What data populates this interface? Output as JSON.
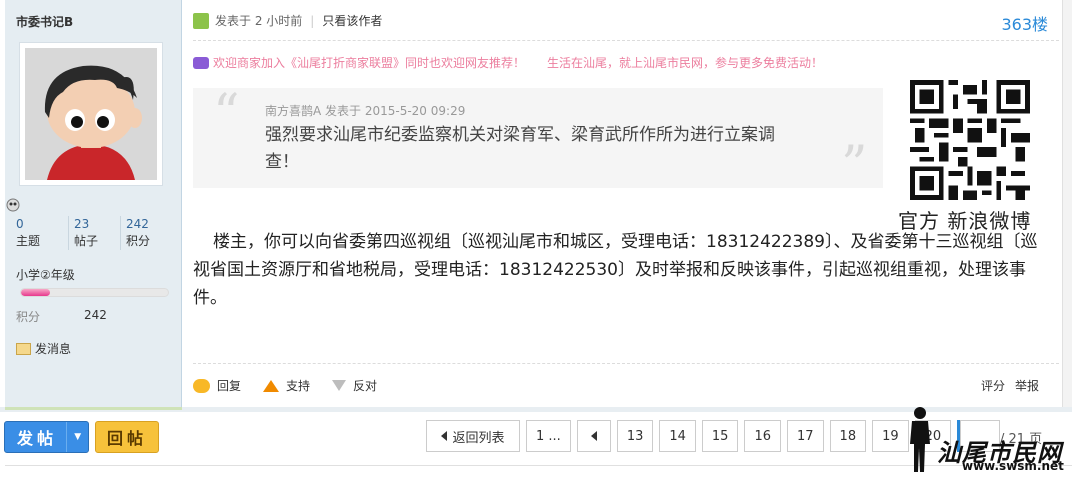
{
  "author": {
    "name": "市委书记B",
    "stats": [
      {
        "value": "0",
        "label": "主题"
      },
      {
        "value": "23",
        "label": "帖子"
      },
      {
        "value": "242",
        "label": "积分"
      }
    ],
    "level": "小学②年级",
    "level_progress": 0.2,
    "points_label": "积分",
    "points_value": "242",
    "pm_label": "发消息"
  },
  "post": {
    "posted_label": "发表于 2 小时前",
    "only_author": "只看该作者",
    "floor": "363楼",
    "ad_left": "欢迎商家加入《汕尾打折商家联盟》同时也欢迎网友推荐！",
    "ad_right": "生活在汕尾，就上汕尾市民网，参与更多免费活动！",
    "quote": {
      "meta": "南方喜鹊A 发表于 2015-5-20 09:29",
      "text": "强烈要求汕尾市纪委监察机关对梁育军、梁育武所作所为进行立案调查！"
    },
    "qr_caption": "官方 新浪微博",
    "body": "楼主，你可以向省委第四巡视组〔巡视汕尾市和城区，受理电话：18312422389〕、及省委第十三巡视组〔巡视省国土资源厅和省地税局，受理电话：18312422530〕及时举报和反映该事件，引起巡视组重视，处理该事件。",
    "actions": {
      "reply": "回复",
      "support": "支持",
      "oppose": "反对",
      "rate": "评分",
      "report": "举报"
    }
  },
  "bottom": {
    "post_button": "发帖",
    "reply_button": "回帖",
    "back_to_list": "返回列表",
    "first_page": "1 ...",
    "pages": [
      "13",
      "14",
      "15",
      "16",
      "17",
      "18",
      "19",
      "20"
    ],
    "current_page": "21",
    "total_pages": "/ 21 页"
  },
  "watermark": {
    "text": "汕尾市民网",
    "url": "www.swsm.net"
  },
  "colors": {
    "accent": "#2b8ad8",
    "ad_pink": "#ec7e9e",
    "post_button": "#3a8ee6",
    "reply_button": "#f7c23b"
  }
}
